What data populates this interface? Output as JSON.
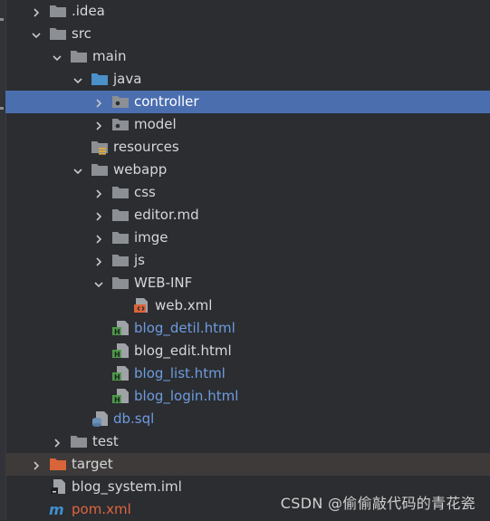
{
  "project_tree": {
    "items": [
      {
        "label": ".idea",
        "icon": "folder-icon",
        "expandable": true,
        "expanded": false
      },
      {
        "label": "src",
        "icon": "folder-icon",
        "expandable": true,
        "expanded": true
      },
      {
        "label": "main",
        "icon": "folder-icon",
        "expandable": true,
        "expanded": true
      },
      {
        "label": "java",
        "icon": "source-folder-icon",
        "expandable": true,
        "expanded": true
      },
      {
        "label": "controller",
        "icon": "package-icon",
        "expandable": true,
        "expanded": false,
        "selected": true
      },
      {
        "label": "model",
        "icon": "package-icon",
        "expandable": true,
        "expanded": false
      },
      {
        "label": "resources",
        "icon": "resources-folder-icon",
        "expandable": false
      },
      {
        "label": "webapp",
        "icon": "folder-icon",
        "expandable": true,
        "expanded": true
      },
      {
        "label": "css",
        "icon": "folder-icon",
        "expandable": true,
        "expanded": false
      },
      {
        "label": "editor.md",
        "icon": "folder-icon",
        "expandable": true,
        "expanded": false
      },
      {
        "label": "imge",
        "icon": "folder-icon",
        "expandable": true,
        "expanded": false
      },
      {
        "label": "js",
        "icon": "folder-icon",
        "expandable": true,
        "expanded": false
      },
      {
        "label": "WEB-INF",
        "icon": "folder-icon",
        "expandable": true,
        "expanded": true
      },
      {
        "label": "web.xml",
        "icon": "xml-file-icon",
        "expandable": false
      },
      {
        "label": "blog_detil.html",
        "icon": "html-file-icon",
        "expandable": false,
        "vcs_status": "added"
      },
      {
        "label": "blog_edit.html",
        "icon": "html-file-icon",
        "expandable": false
      },
      {
        "label": "blog_list.html",
        "icon": "html-file-icon",
        "expandable": false,
        "vcs_status": "added"
      },
      {
        "label": "blog_login.html",
        "icon": "html-file-icon",
        "expandable": false,
        "vcs_status": "added"
      },
      {
        "label": "db.sql",
        "icon": "sql-file-icon",
        "expandable": false,
        "vcs_status": "added"
      },
      {
        "label": "test",
        "icon": "folder-icon",
        "expandable": true,
        "expanded": false
      },
      {
        "label": "target",
        "icon": "excluded-folder-icon",
        "expandable": true,
        "expanded": false,
        "excluded": true
      },
      {
        "label": "blog_system.iml",
        "icon": "iml-file-icon",
        "expandable": false
      },
      {
        "label": "pom.xml",
        "icon": "maven-icon",
        "expandable": false,
        "vcs_status": "modified"
      }
    ]
  },
  "watermark": "CSDN @偷偷敲代码的青花瓷",
  "colors": {
    "background": "#2b2d30",
    "selection": "#4b6eaf",
    "folder": "#8c8f94",
    "source_folder": "#4a90c9",
    "added_text": "#6f9be0",
    "modified_text": "#e0643f",
    "excluded_folder": "#d9643a",
    "html_icon": "#4e9a4a"
  }
}
